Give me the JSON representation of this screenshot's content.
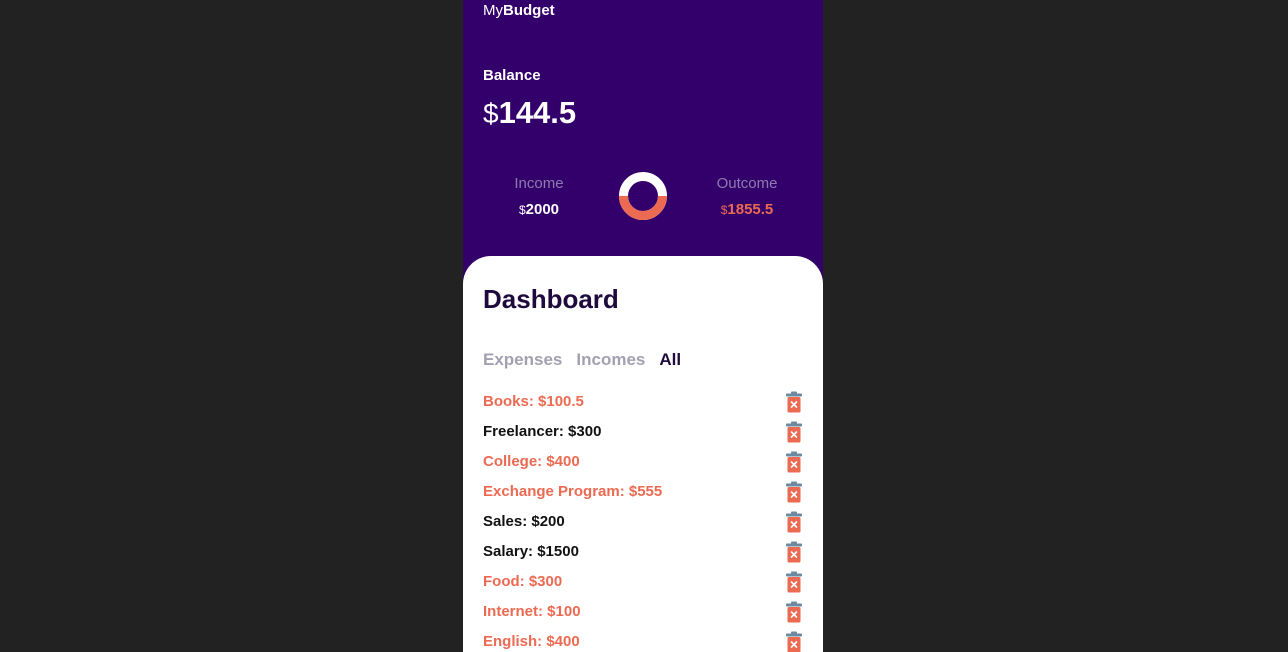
{
  "brand": {
    "prefix": "My",
    "name": "Budget"
  },
  "balance": {
    "label": "Balance",
    "currency": "$",
    "amount": "144.5"
  },
  "income": {
    "label": "Income",
    "currency": "$",
    "amount": "2000"
  },
  "outcome": {
    "label": "Outcome",
    "currency": "$",
    "amount": "1855.5"
  },
  "colors": {
    "header_bg": "#33006b",
    "expense": "#ec6a52",
    "income_text": "#111111",
    "trash_lid": "#6b8aa0"
  },
  "dashboard": {
    "title": "Dashboard",
    "tabs": [
      {
        "label": "Expenses",
        "active": false
      },
      {
        "label": "Incomes",
        "active": false
      },
      {
        "label": "All",
        "active": true
      }
    ],
    "entries": [
      {
        "text": "Books: $100.5",
        "kind": "expense",
        "icon": "trash-icon"
      },
      {
        "text": "Freelancer: $300",
        "kind": "income",
        "icon": "trash-icon"
      },
      {
        "text": "College: $400",
        "kind": "expense",
        "icon": "trash-icon"
      },
      {
        "text": "Exchange Program: $555",
        "kind": "expense",
        "icon": "trash-icon"
      },
      {
        "text": "Sales: $200",
        "kind": "income",
        "icon": "trash-icon"
      },
      {
        "text": "Salary: $1500",
        "kind": "income",
        "icon": "trash-icon"
      },
      {
        "text": "Food: $300",
        "kind": "expense",
        "icon": "trash-icon"
      },
      {
        "text": "Internet: $100",
        "kind": "expense",
        "icon": "trash-icon"
      },
      {
        "text": "English: $400",
        "kind": "expense",
        "icon": "trash-icon"
      }
    ]
  }
}
